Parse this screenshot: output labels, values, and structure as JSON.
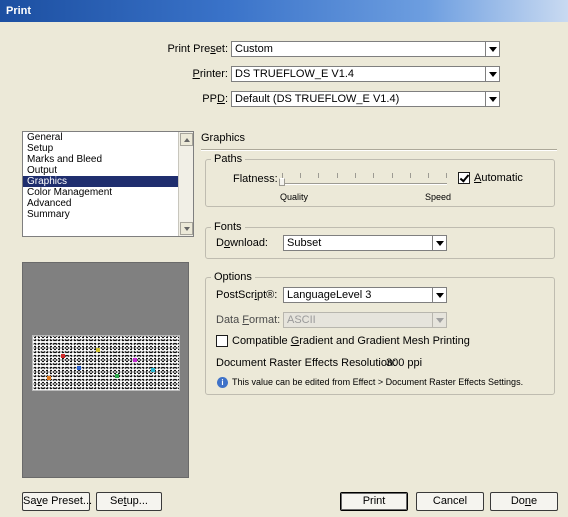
{
  "window": {
    "title": "Print"
  },
  "top_fields": {
    "print_preset": {
      "label_pre": "Print Pre",
      "label_key": "s",
      "label_post": "et:",
      "value": "Custom"
    },
    "printer": {
      "label_key": "P",
      "label_post": "rinter:",
      "value": "DS TRUEFLOW_E V1.4"
    },
    "ppd": {
      "label_pre": "PP",
      "label_key": "D",
      "label_post": ":",
      "value": "Default (DS TRUEFLOW_E V1.4)"
    }
  },
  "categories": {
    "items": [
      "General",
      "Setup",
      "Marks and Bleed",
      "Output",
      "Graphics",
      "Color Management",
      "Advanced",
      "Summary"
    ],
    "selected": "Graphics"
  },
  "section_title": "Graphics",
  "paths": {
    "legend": "Paths",
    "flatness_label": "Flatness:",
    "quality_label": "Quality",
    "speed_label": "Speed",
    "automatic_key": "A",
    "automatic_rest": "utomatic",
    "automatic_checked": true,
    "flatness_position": 0
  },
  "fonts": {
    "legend": "Fonts",
    "download_pre": "D",
    "download_key": "o",
    "download_post": "wnload:",
    "download_value": "Subset"
  },
  "options": {
    "legend": "Options",
    "postscript_pre": "PostScr",
    "postscript_key": "i",
    "postscript_post": "pt®:",
    "postscript_value": "LanguageLevel 3",
    "data_format_pre": "Data ",
    "data_format_key": "F",
    "data_format_post": "ormat:",
    "data_format_value": "ASCII",
    "compat_pre": "Compatible ",
    "compat_key": "G",
    "compat_post": "radient and Gradient Mesh Printing",
    "compat_checked": false,
    "raster_label": "Document Raster Effects Resolution:",
    "raster_value": "300 ppi",
    "info_text": "This value can be edited from Effect > Document Raster Effects Settings."
  },
  "buttons": {
    "save_preset_pre": "Sa",
    "save_preset_key": "v",
    "save_preset_post": "e Preset...",
    "setup_pre": "Se",
    "setup_key": "t",
    "setup_post": "up...",
    "print": "Print",
    "cancel": "Cancel",
    "done_pre": "Do",
    "done_key": "n",
    "done_post": "e"
  }
}
